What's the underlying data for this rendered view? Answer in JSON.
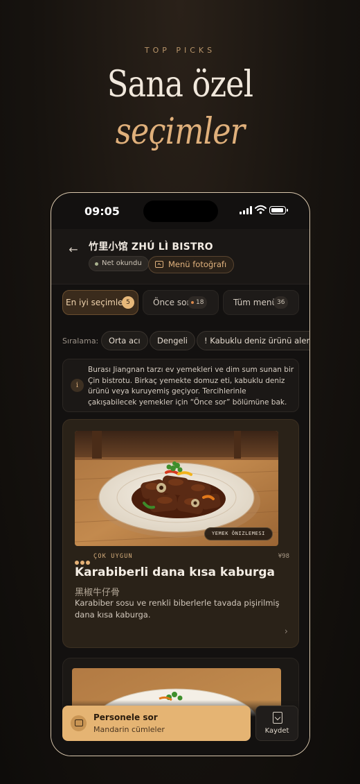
{
  "promo": {
    "eyebrow": "TOP PICKS",
    "headline_line1": "Sana özel",
    "headline_line2": "seçimler"
  },
  "status_bar": {
    "time": "09:05"
  },
  "header": {
    "title": "竹里小馆 ZHÚ LÌ BISTRO",
    "status_chip": "Net okundu",
    "menu_photo_button": "Menü fotoğrafı"
  },
  "tabs": [
    {
      "label": "En iyi seçimler",
      "count": "5",
      "active": true
    },
    {
      "label": "Önce sor",
      "count": "18",
      "active": false
    },
    {
      "label": "Tüm menü",
      "count": "36",
      "active": false
    }
  ],
  "sort": {
    "label": "Sıralama:",
    "options": [
      "Orta acı",
      "Dengeli",
      "! Kabuklu deniz ürünü alerjisi"
    ]
  },
  "info_note": "Burası Jiangnan tarzı ev yemekleri ve dim sum sunan bir Çin bistrotu. Birkaç yemekte domuz eti, kabuklu deniz ürünü veya kuruyemiş geçiyor. Tercihlerinle çakışabilecek yemekler için “Önce sor” bölümüne bak.",
  "dish_card": {
    "preview_badge": "YEMEK ÖNIZLEMESI",
    "fit_level": 3,
    "fit_label": "ÇOK UYGUN",
    "price": "¥98",
    "name": "Karabiberli dana kısa kaburga",
    "name_cn": "黑椒牛仔骨",
    "description": "Karabiber sosu ve renkli biberlerle tavada pişirilmiş dana kısa kaburga."
  },
  "actions": {
    "ask_title": "Personele sor",
    "ask_subtitle": "Mandarin cümleler",
    "save_label": "Kaydet"
  },
  "colors": {
    "accent": "#e5b473",
    "background": "#131110",
    "card": "#2a2218"
  }
}
